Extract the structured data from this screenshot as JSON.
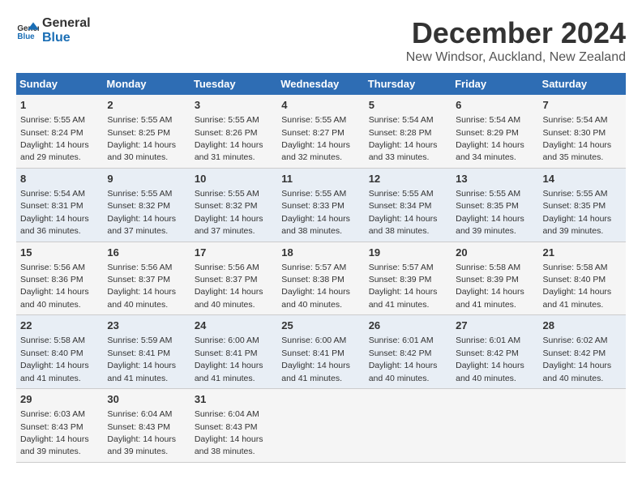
{
  "logo": {
    "line1": "General",
    "line2": "Blue"
  },
  "title": "December 2024",
  "subtitle": "New Windsor, Auckland, New Zealand",
  "days_header": [
    "Sunday",
    "Monday",
    "Tuesday",
    "Wednesday",
    "Thursday",
    "Friday",
    "Saturday"
  ],
  "weeks": [
    [
      {
        "num": "1",
        "rise": "5:55 AM",
        "set": "8:24 PM",
        "daylight": "14 hours and 29 minutes."
      },
      {
        "num": "2",
        "rise": "5:55 AM",
        "set": "8:25 PM",
        "daylight": "14 hours and 30 minutes."
      },
      {
        "num": "3",
        "rise": "5:55 AM",
        "set": "8:26 PM",
        "daylight": "14 hours and 31 minutes."
      },
      {
        "num": "4",
        "rise": "5:55 AM",
        "set": "8:27 PM",
        "daylight": "14 hours and 32 minutes."
      },
      {
        "num": "5",
        "rise": "5:54 AM",
        "set": "8:28 PM",
        "daylight": "14 hours and 33 minutes."
      },
      {
        "num": "6",
        "rise": "5:54 AM",
        "set": "8:29 PM",
        "daylight": "14 hours and 34 minutes."
      },
      {
        "num": "7",
        "rise": "5:54 AM",
        "set": "8:30 PM",
        "daylight": "14 hours and 35 minutes."
      }
    ],
    [
      {
        "num": "8",
        "rise": "5:54 AM",
        "set": "8:31 PM",
        "daylight": "14 hours and 36 minutes."
      },
      {
        "num": "9",
        "rise": "5:55 AM",
        "set": "8:32 PM",
        "daylight": "14 hours and 37 minutes."
      },
      {
        "num": "10",
        "rise": "5:55 AM",
        "set": "8:32 PM",
        "daylight": "14 hours and 37 minutes."
      },
      {
        "num": "11",
        "rise": "5:55 AM",
        "set": "8:33 PM",
        "daylight": "14 hours and 38 minutes."
      },
      {
        "num": "12",
        "rise": "5:55 AM",
        "set": "8:34 PM",
        "daylight": "14 hours and 38 minutes."
      },
      {
        "num": "13",
        "rise": "5:55 AM",
        "set": "8:35 PM",
        "daylight": "14 hours and 39 minutes."
      },
      {
        "num": "14",
        "rise": "5:55 AM",
        "set": "8:35 PM",
        "daylight": "14 hours and 39 minutes."
      }
    ],
    [
      {
        "num": "15",
        "rise": "5:56 AM",
        "set": "8:36 PM",
        "daylight": "14 hours and 40 minutes."
      },
      {
        "num": "16",
        "rise": "5:56 AM",
        "set": "8:37 PM",
        "daylight": "14 hours and 40 minutes."
      },
      {
        "num": "17",
        "rise": "5:56 AM",
        "set": "8:37 PM",
        "daylight": "14 hours and 40 minutes."
      },
      {
        "num": "18",
        "rise": "5:57 AM",
        "set": "8:38 PM",
        "daylight": "14 hours and 40 minutes."
      },
      {
        "num": "19",
        "rise": "5:57 AM",
        "set": "8:39 PM",
        "daylight": "14 hours and 41 minutes."
      },
      {
        "num": "20",
        "rise": "5:58 AM",
        "set": "8:39 PM",
        "daylight": "14 hours and 41 minutes."
      },
      {
        "num": "21",
        "rise": "5:58 AM",
        "set": "8:40 PM",
        "daylight": "14 hours and 41 minutes."
      }
    ],
    [
      {
        "num": "22",
        "rise": "5:58 AM",
        "set": "8:40 PM",
        "daylight": "14 hours and 41 minutes."
      },
      {
        "num": "23",
        "rise": "5:59 AM",
        "set": "8:41 PM",
        "daylight": "14 hours and 41 minutes."
      },
      {
        "num": "24",
        "rise": "6:00 AM",
        "set": "8:41 PM",
        "daylight": "14 hours and 41 minutes."
      },
      {
        "num": "25",
        "rise": "6:00 AM",
        "set": "8:41 PM",
        "daylight": "14 hours and 41 minutes."
      },
      {
        "num": "26",
        "rise": "6:01 AM",
        "set": "8:42 PM",
        "daylight": "14 hours and 40 minutes."
      },
      {
        "num": "27",
        "rise": "6:01 AM",
        "set": "8:42 PM",
        "daylight": "14 hours and 40 minutes."
      },
      {
        "num": "28",
        "rise": "6:02 AM",
        "set": "8:42 PM",
        "daylight": "14 hours and 40 minutes."
      }
    ],
    [
      {
        "num": "29",
        "rise": "6:03 AM",
        "set": "8:43 PM",
        "daylight": "14 hours and 39 minutes."
      },
      {
        "num": "30",
        "rise": "6:04 AM",
        "set": "8:43 PM",
        "daylight": "14 hours and 39 minutes."
      },
      {
        "num": "31",
        "rise": "6:04 AM",
        "set": "8:43 PM",
        "daylight": "14 hours and 38 minutes."
      },
      null,
      null,
      null,
      null
    ]
  ],
  "labels": {
    "sunrise": "Sunrise:",
    "sunset": "Sunset:",
    "daylight": "Daylight:"
  }
}
